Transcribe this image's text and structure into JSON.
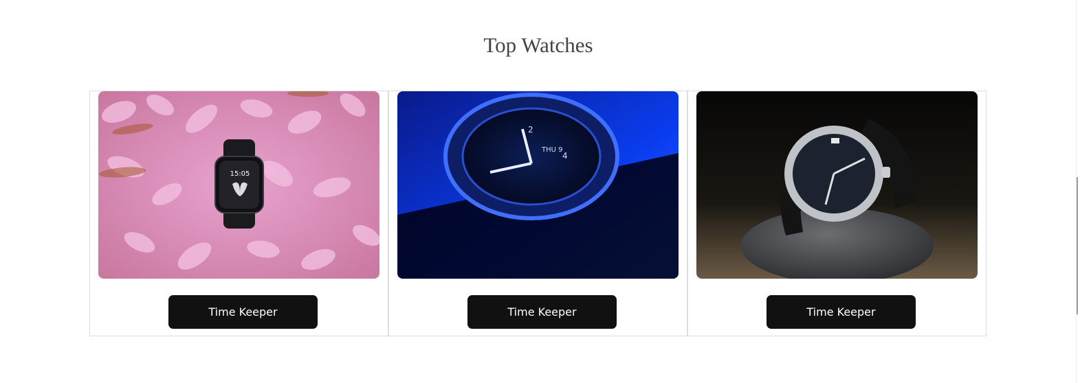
{
  "section": {
    "title": "Top Watches"
  },
  "cards": [
    {
      "image_icon": "smartwatch-on-petals-image",
      "button_label": "Time Keeper"
    },
    {
      "image_icon": "blue-smartwatch-image",
      "button_label": "Time Keeper"
    },
    {
      "image_icon": "analog-watch-on-stone-image",
      "button_label": "Time Keeper"
    }
  ],
  "colors": {
    "button_bg": "#111111",
    "button_text": "#ffffff",
    "title": "#444444",
    "card_border": "#dddddd"
  }
}
